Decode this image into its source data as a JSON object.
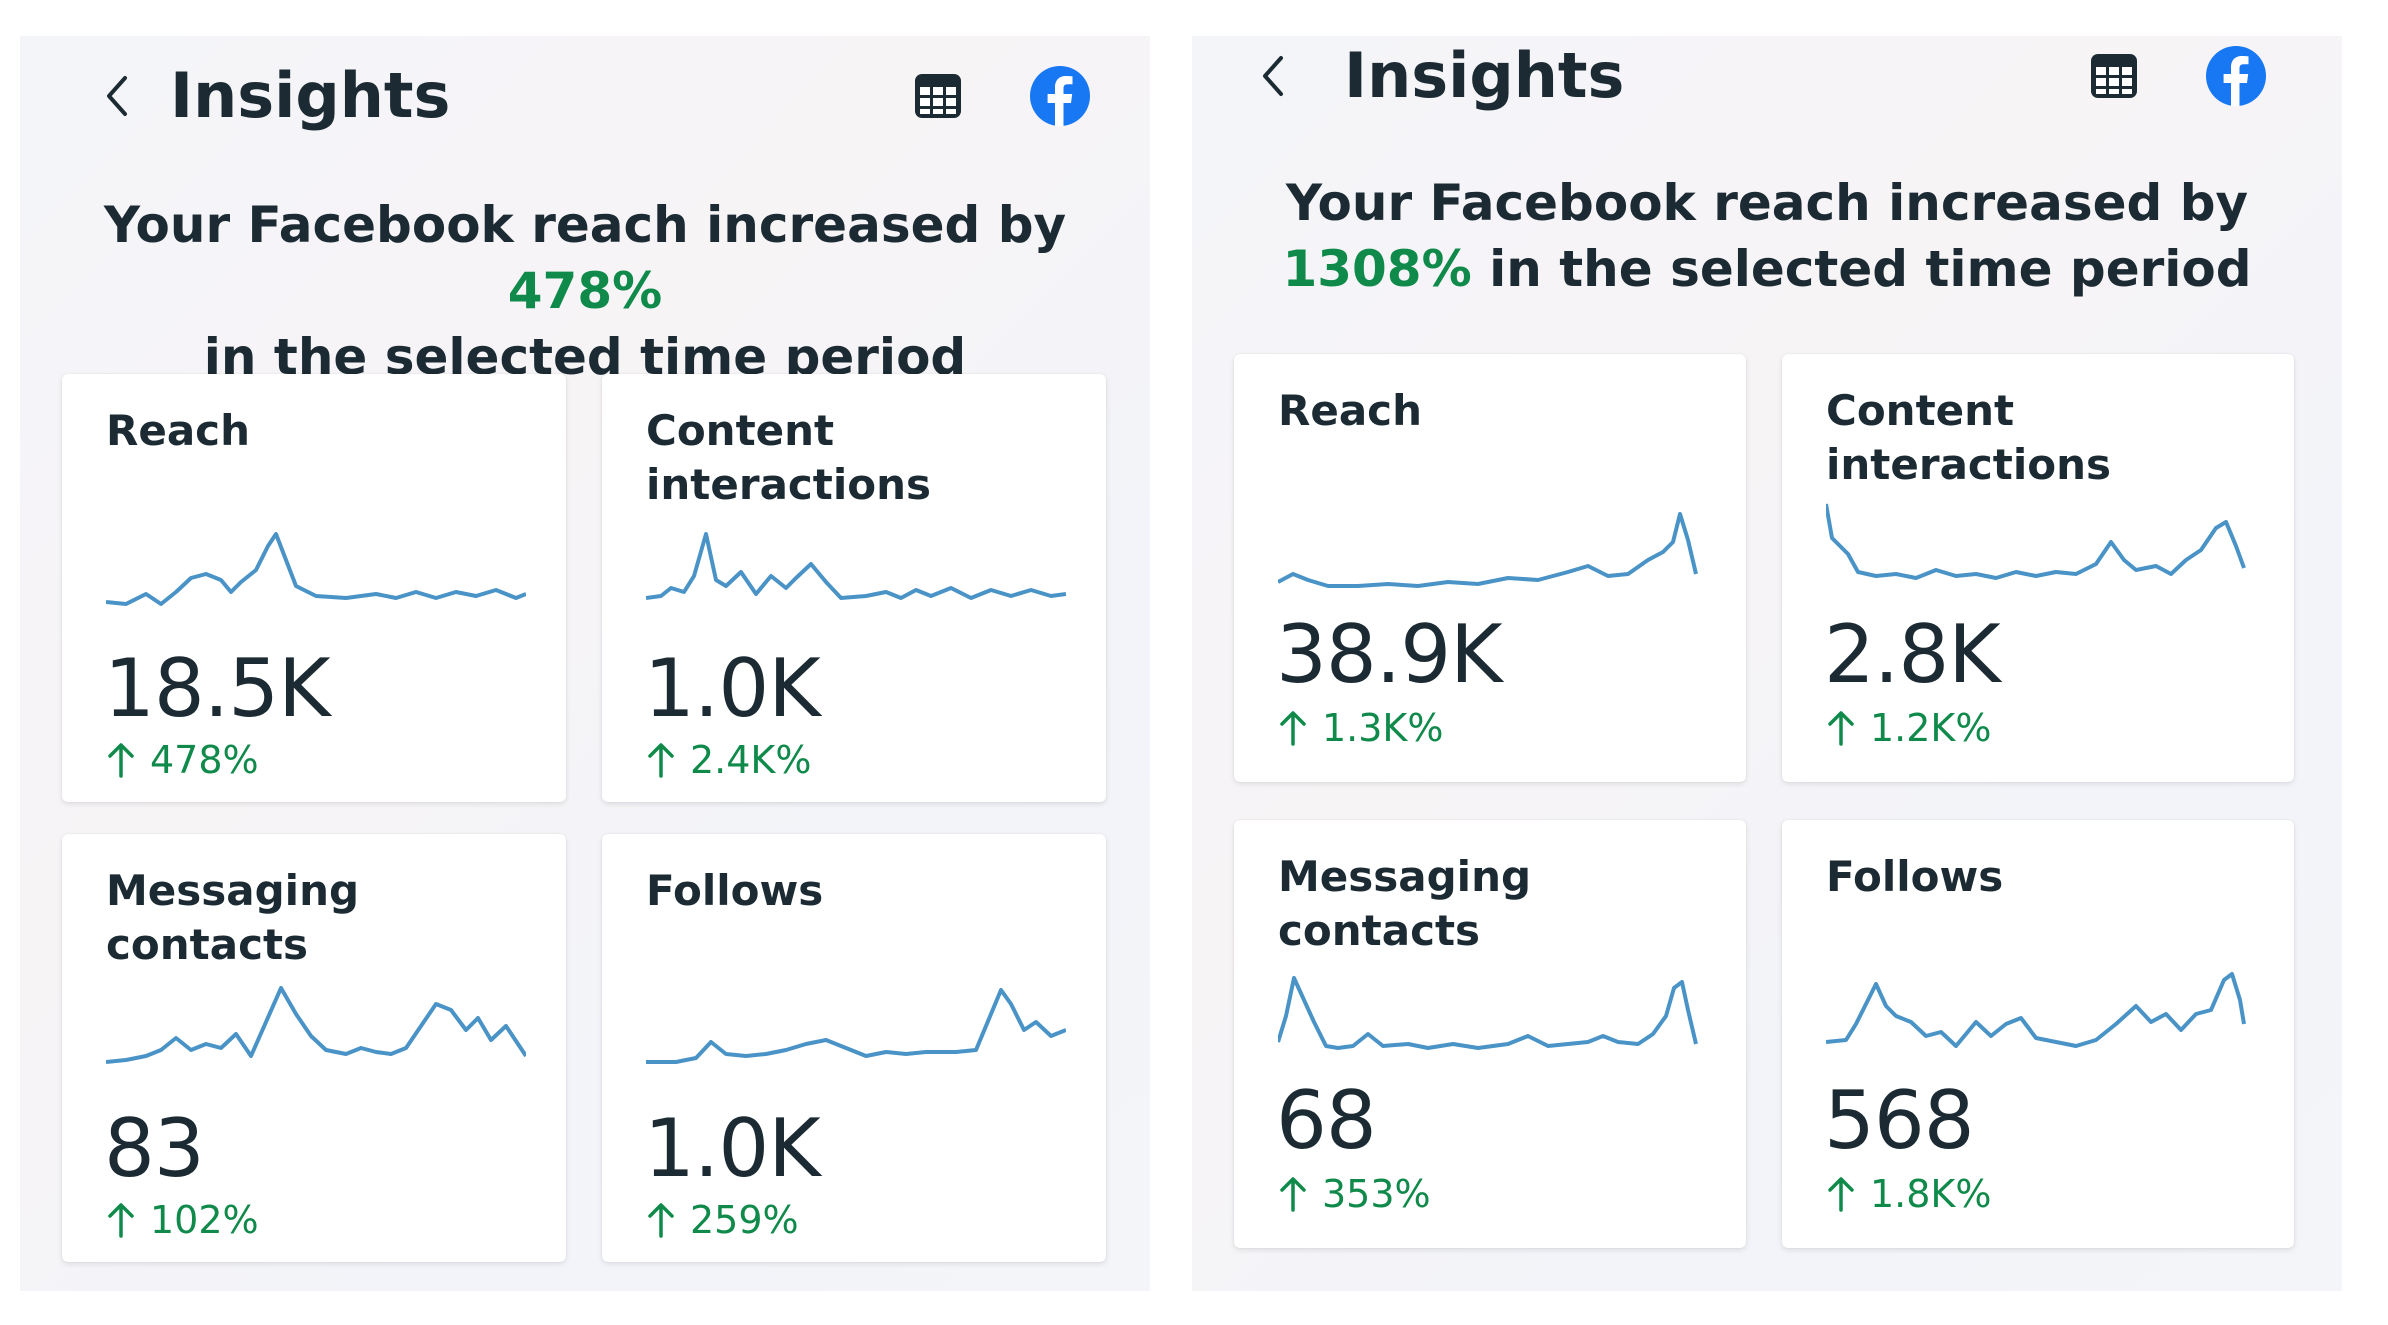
{
  "panels": [
    {
      "title": "Insights",
      "headline_before": "Your Facebook reach increased by ",
      "headline_pct": "478%",
      "headline_after": " in the selected time period",
      "cards": [
        {
          "title": "Reach",
          "value": "18.5K",
          "change": "478%"
        },
        {
          "title": "Content interactions",
          "value": "1.0K",
          "change": "2.4K%"
        },
        {
          "title": "Messaging contacts",
          "value": "83",
          "change": "102%"
        },
        {
          "title": "Follows",
          "value": "1.0K",
          "change": "259%"
        }
      ]
    },
    {
      "title": "Insights",
      "headline_before": "Your Facebook reach increased by ",
      "headline_pct": "1308%",
      "headline_after": " in the selected time period",
      "cards": [
        {
          "title": "Reach",
          "value": "38.9K",
          "change": "1.3K%"
        },
        {
          "title": "Content interactions",
          "value": "2.8K",
          "change": "1.2K%"
        },
        {
          "title": "Messaging contacts",
          "value": "68",
          "change": "353%"
        },
        {
          "title": "Follows",
          "value": "568",
          "change": "1.8K%"
        }
      ]
    }
  ],
  "colors": {
    "positive": "#0f8a4a",
    "sparkline": "#4a93c7",
    "facebook": "#1877f2"
  },
  "icons": {
    "back": "chevron-left-icon",
    "table": "table-icon",
    "facebook": "facebook-logo-icon",
    "change": "arrow-up-icon"
  }
}
